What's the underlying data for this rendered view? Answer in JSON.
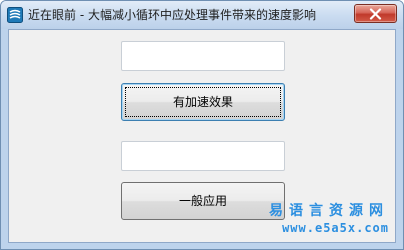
{
  "window": {
    "title": "近在眼前 - 大幅减小循环中应处理事件带来的速度影响",
    "icon": "app-logo-icon",
    "close_icon": "close-icon"
  },
  "form": {
    "input1": {
      "value": "",
      "placeholder": ""
    },
    "button1_label": "有加速效果",
    "input2": {
      "value": "",
      "placeholder": ""
    },
    "button2_label": "一般应用"
  },
  "watermark": {
    "line1": "易语言资源网",
    "line2": "www.e5a5x.com"
  },
  "colors": {
    "titlebar": "#c9dbf0",
    "client_bg": "#f0f0f0",
    "close_button": "#c0392b",
    "watermark": "#2c8fe0"
  }
}
